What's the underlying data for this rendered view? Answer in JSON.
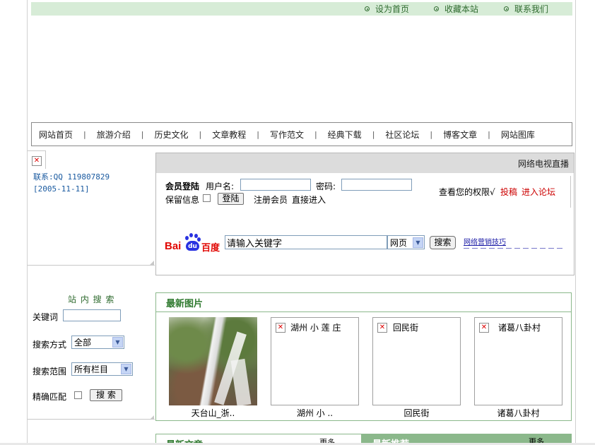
{
  "top_links": [
    {
      "label": "设为首页"
    },
    {
      "label": "收藏本站"
    },
    {
      "label": "联系我们"
    }
  ],
  "nav": {
    "items": [
      "网站首页",
      "旅游介绍",
      "历史文化",
      "文章教程",
      "写作范文",
      "经典下载",
      "社区论坛",
      "博客文章",
      "网站图库"
    ],
    "separator": "|"
  },
  "sidebar": {
    "contact": "联系:QQ 119807829",
    "date": "[2005-11-11]",
    "search_title": "站 内 搜 索",
    "keyword_label": "关键词",
    "method_label": "搜索方式",
    "method_value": "全部",
    "range_label": "搜索范围",
    "range_value": "所有栏目",
    "exact_label": "精确匹配",
    "search_button": "搜 索"
  },
  "header_strip": {
    "tv_link": "网络电视直播"
  },
  "login": {
    "title": "会员登陆",
    "username_label": "用户名:",
    "password_label": "密码:",
    "remember_label": "保留信息",
    "login_button": "登陆",
    "register_link": "注册会员",
    "direct_link": "直接进入",
    "rights_text": "查看您的权限√",
    "submit_link": "投稿",
    "forum_link": "进入论坛"
  },
  "baidu": {
    "logo_bai": "Bai",
    "logo_du": "du",
    "logo_cn": "百度",
    "search_value": "请输入关键字",
    "type_value": "网页",
    "search_button": "搜索",
    "promo_text": "网络营销技巧"
  },
  "latest_photos": {
    "title": "最新图片",
    "items": [
      {
        "caption": "天台山_浙..",
        "alt": ""
      },
      {
        "caption": "湖州 小 ..",
        "alt": "湖州 小 莲 庄"
      },
      {
        "caption": "回民街",
        "alt": "回民街"
      },
      {
        "caption": "诸葛八卦村",
        "alt": "诸葛八卦村"
      }
    ]
  },
  "bottom": {
    "latest_articles": "最新文章",
    "col_rank_1": "更多",
    "latest_recommend": "最新推荐",
    "col_rank_2": "更多"
  },
  "colors": {
    "top_bar": "#d7ecd7",
    "green_text": "#2f6b2f",
    "accent_red": "#cc0000",
    "baidu_blue": "#2932e1",
    "baidu_red": "#e10602"
  }
}
